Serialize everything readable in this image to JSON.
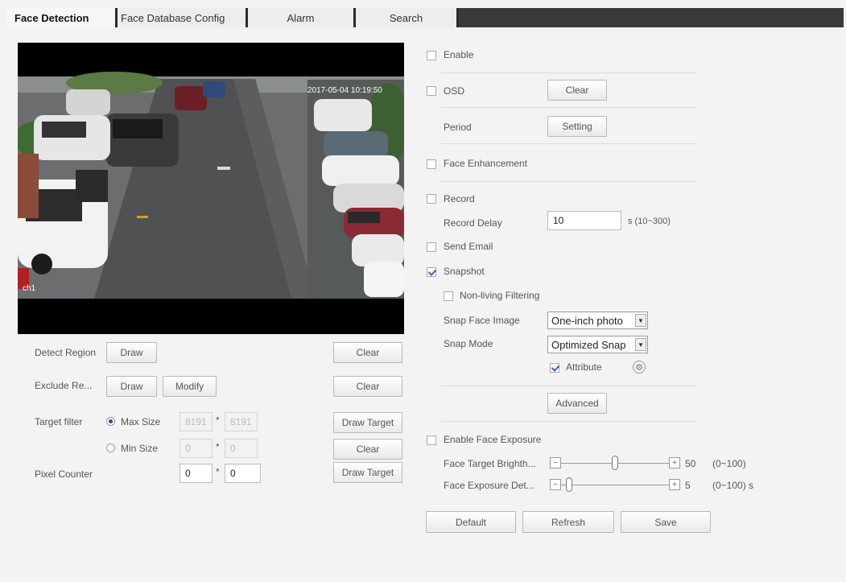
{
  "tabs": [
    {
      "label": "Face Detection"
    },
    {
      "label": "Face Database Config"
    },
    {
      "label": "Alarm"
    },
    {
      "label": "Search"
    }
  ],
  "video": {
    "timestamp": "2017-05-04 10:19:50",
    "channel_label": "ch1"
  },
  "left_panel": {
    "detect_region_label": "Detect Region",
    "exclude_region_label": "Exclude Re...",
    "draw_label": "Draw",
    "modify_label": "Modify",
    "clear_label": "Clear",
    "target_filter_label": "Target filter",
    "max_size_label": "Max Size",
    "min_size_label": "Min Size",
    "max_w": "8191",
    "max_h": "8191",
    "min_w": "0",
    "min_h": "0",
    "star": "*",
    "draw_target_label": "Draw Target",
    "pixel_counter_label": "Pixel Counter",
    "pixel_w": "0",
    "pixel_h": "0"
  },
  "right_panel": {
    "enable_label": "Enable",
    "osd_label": "OSD",
    "clear_label": "Clear",
    "period_label": "Period",
    "setting_label": "Setting",
    "face_enhancement_label": "Face Enhancement",
    "record_label": "Record",
    "record_delay_label": "Record Delay",
    "record_delay_value": "10",
    "record_delay_range": "s (10~300)",
    "send_email_label": "Send Email",
    "snapshot_label": "Snapshot",
    "nonliving_label": "Non-living Filtering",
    "snap_face_image_label": "Snap Face Image",
    "snap_face_image_value": "One-inch photo",
    "snap_mode_label": "Snap Mode",
    "snap_mode_value": "Optimized Snap",
    "attribute_label": "Attribute",
    "advanced_label": "Advanced",
    "enable_face_exposure_label": "Enable Face Exposure",
    "face_target_brightness_label": "Face Target Brighth...",
    "face_target_brightness_value": "50",
    "face_target_brightness_fraction": 0.5,
    "face_target_brightness_range": "(0~100)",
    "face_exposure_detect_label": "Face Exposure Det...",
    "face_exposure_detect_value": "5",
    "face_exposure_detect_fraction": 0.05,
    "face_exposure_detect_range": "(0~100) s",
    "minus": "−",
    "plus": "+"
  },
  "footer": {
    "default_label": "Default",
    "refresh_label": "Refresh",
    "save_label": "Save"
  },
  "checkbox_states": {
    "enable": false,
    "osd": false,
    "face_enhancement": false,
    "record": false,
    "send_email": false,
    "snapshot": true,
    "nonliving": false,
    "attribute": true,
    "enable_face_exposure": false
  },
  "colors": {
    "tab_bar": "#3a3a3a",
    "accent": "#2a50a0"
  }
}
